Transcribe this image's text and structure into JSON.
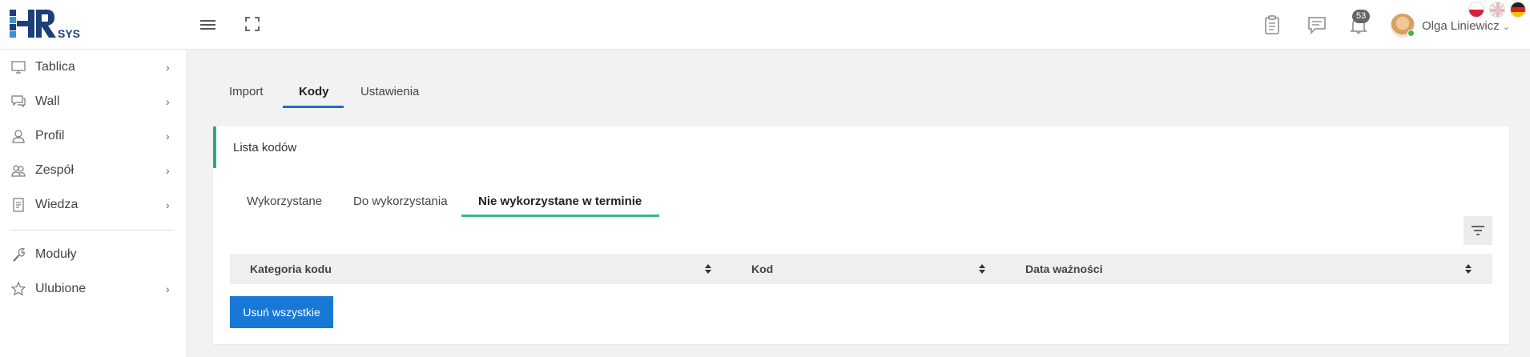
{
  "header": {
    "logo_text": "HRSYS",
    "notification_count": "53",
    "user_name": "Olga Liniewicz",
    "languages": [
      "pl-flag-icon",
      "gb-flag-icon",
      "de-flag-icon"
    ]
  },
  "sidebar": {
    "items": [
      {
        "label": "Tablica",
        "icon": "monitor-icon"
      },
      {
        "label": "Wall",
        "icon": "chat-icon"
      },
      {
        "label": "Profil",
        "icon": "user-icon"
      },
      {
        "label": "Zespół",
        "icon": "team-icon"
      },
      {
        "label": "Wiedza",
        "icon": "document-icon"
      },
      {
        "label": "Moduły",
        "icon": "wrench-icon"
      },
      {
        "label": "Ulubione",
        "icon": "star-icon"
      }
    ]
  },
  "tabs": {
    "items": [
      "Import",
      "Kody",
      "Ustawienia"
    ],
    "active": "Kody"
  },
  "card": {
    "title": "Lista kodów",
    "subtabs": [
      "Wykorzystane",
      "Do wykorzystania",
      "Nie wykorzystane w terminie"
    ],
    "active_subtab": "Nie wykorzystane w terminie",
    "columns": [
      "Kategoria kodu",
      "Kod",
      "Data ważności"
    ],
    "rows": [],
    "delete_all_label": "Usuń wszystkie"
  },
  "colors": {
    "primary": "#1778d6",
    "tab_underline": "#1f6fc5",
    "accent_green": "#2eaa7f",
    "logo_dark": "#1d3f78",
    "logo_light": "#3d8fd9"
  }
}
